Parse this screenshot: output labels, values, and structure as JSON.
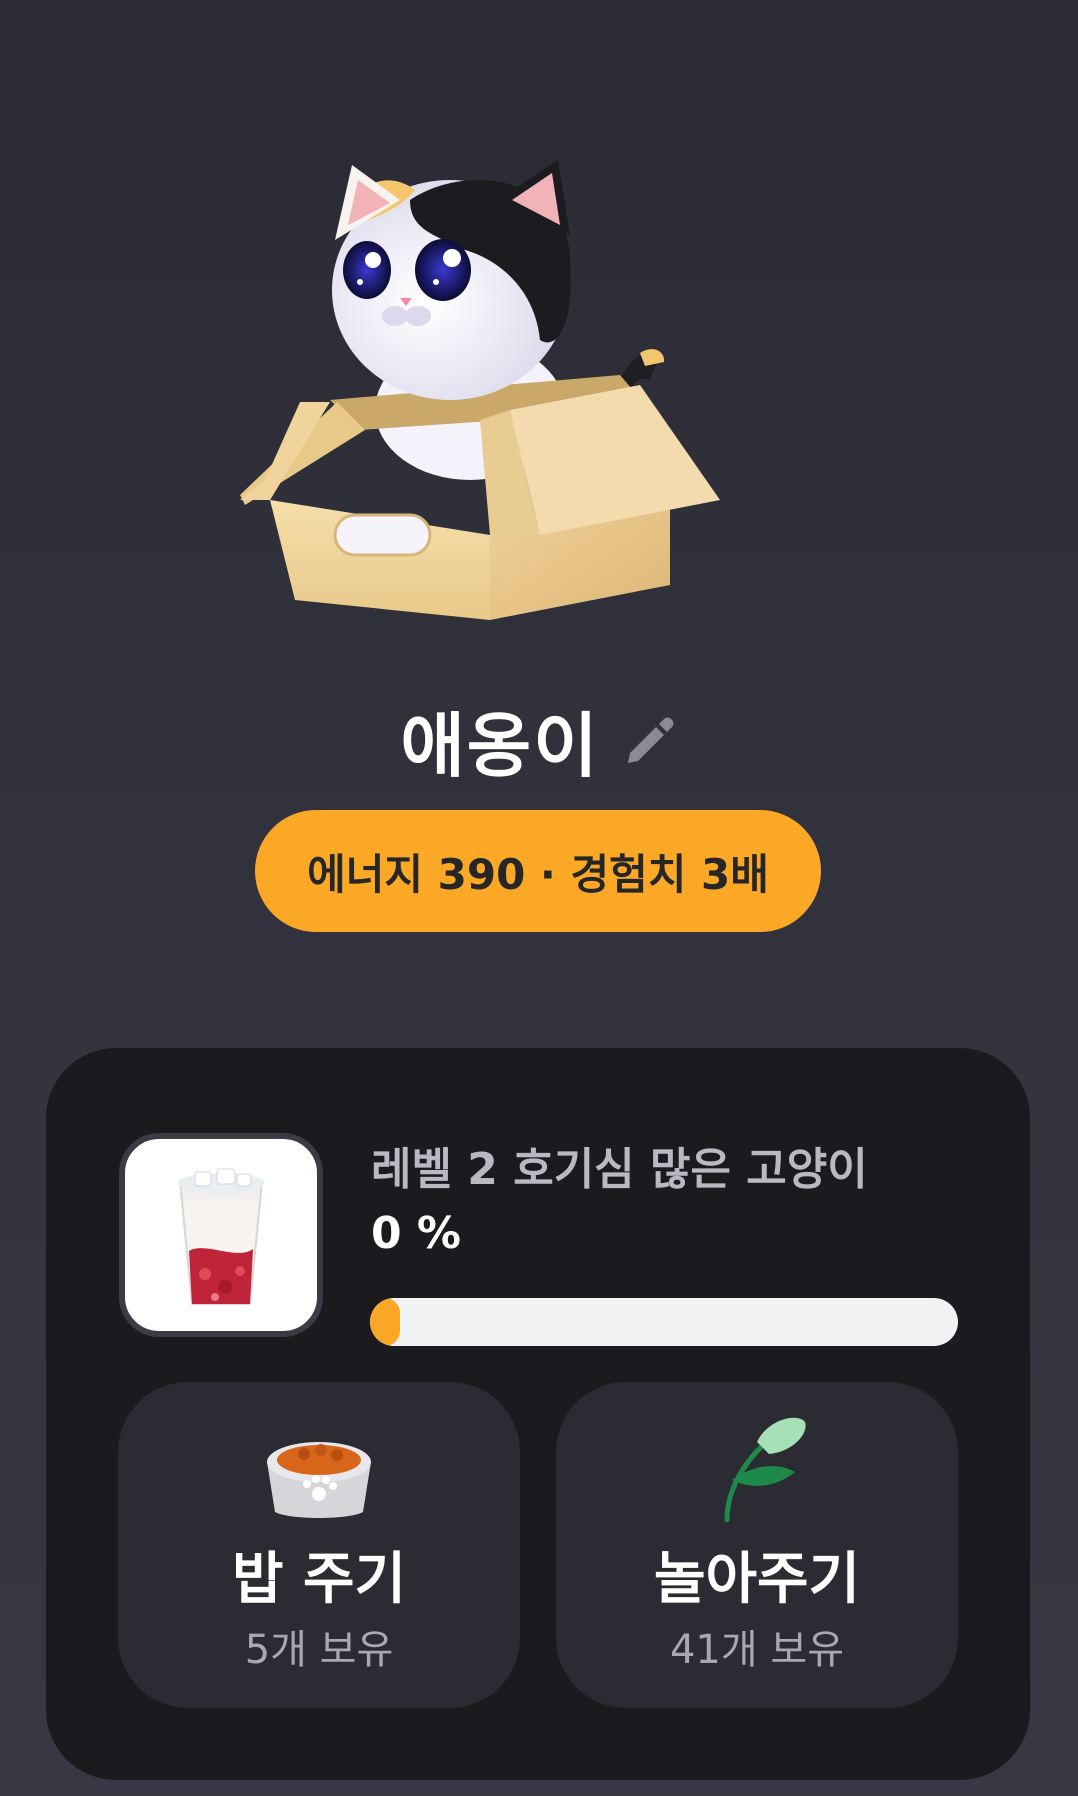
{
  "pet": {
    "name": "애옹이",
    "image_icon": "cat-in-box",
    "edit_icon": "pencil-icon"
  },
  "stats": {
    "label": "에너지 390 · 경험치 3배",
    "accent_color": "#fba826"
  },
  "level": {
    "title": "레벨 2 호기심 많은 고양이",
    "percent_text": "0 %",
    "progress_value": 0,
    "reward_icon": "strawberry-latte-drink"
  },
  "actions": [
    {
      "label": "밥 주기",
      "count": "5개 보유",
      "icon": "pet-food-bowl-icon"
    },
    {
      "label": "놀아주기",
      "count": "41개 보유",
      "icon": "feather-toy-icon"
    }
  ]
}
